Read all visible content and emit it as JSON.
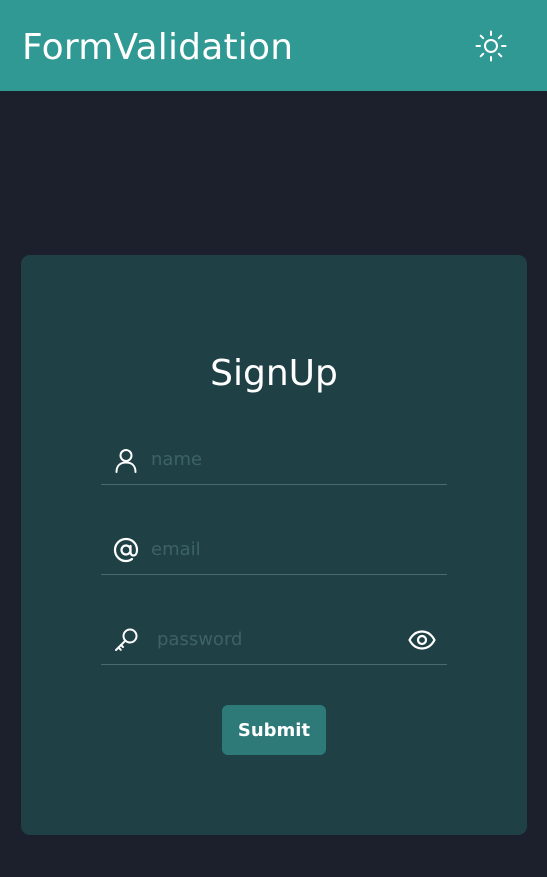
{
  "header": {
    "title": "FormValidation",
    "theme_toggle_icon": "sun-icon"
  },
  "form": {
    "title": "SignUp",
    "fields": [
      {
        "icon": "user-icon",
        "placeholder": "name",
        "type": "text",
        "value": ""
      },
      {
        "icon": "at-sign-icon",
        "placeholder": "email",
        "type": "email",
        "value": ""
      },
      {
        "icon": "key-icon",
        "placeholder": "password",
        "type": "password",
        "value": "",
        "toggle_icon": "eye-icon"
      }
    ],
    "submit_label": "Submit"
  },
  "colors": {
    "header_background": "#319994",
    "page_background": "#1b202c",
    "card_background": "#1f4146",
    "button_background": "#2d7a79",
    "placeholder": "#3d6266",
    "divider": "#4a6a6d"
  }
}
